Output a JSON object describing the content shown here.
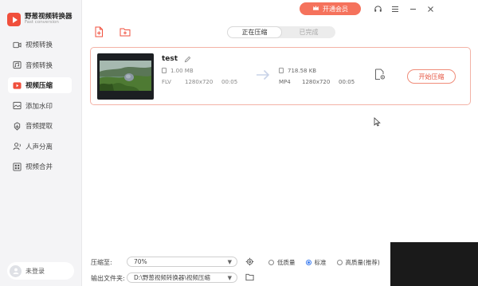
{
  "app": {
    "title": "野葱视频转换器",
    "subtitle": "Fast conversion"
  },
  "sidebar": {
    "items": [
      {
        "label": "视频转换",
        "icon": "video-convert-icon",
        "active": false
      },
      {
        "label": "音频转换",
        "icon": "audio-convert-icon",
        "active": false
      },
      {
        "label": "视频压缩",
        "icon": "video-compress-icon",
        "active": true
      },
      {
        "label": "添加水印",
        "icon": "watermark-icon",
        "active": false
      },
      {
        "label": "音频提取",
        "icon": "audio-extract-icon",
        "active": false
      },
      {
        "label": "人声分离",
        "icon": "vocal-separate-icon",
        "active": false
      },
      {
        "label": "视频合并",
        "icon": "video-merge-icon",
        "active": false
      }
    ],
    "user_label": "未登录"
  },
  "titlebar": {
    "vip_label": "开通会员"
  },
  "tabs": [
    {
      "label": "正在压缩",
      "active": true
    },
    {
      "label": "已完成",
      "active": false
    }
  ],
  "file": {
    "name": "test",
    "source": {
      "size": "1.00 MB",
      "format": "FLV",
      "resolution": "1280x720",
      "duration": "00:05"
    },
    "target": {
      "size": "718.58 KB",
      "format": "MP4",
      "resolution": "1280x720",
      "duration": "00:05"
    },
    "start_label": "开始压缩"
  },
  "bottom": {
    "ratio_label": "压缩至:",
    "ratio_value": "70%",
    "quality_options": [
      {
        "label": "低质量",
        "selected": false
      },
      {
        "label": "标准",
        "selected": true
      },
      {
        "label": "高质量(推荐)",
        "selected": false
      }
    ],
    "output_label": "输出文件夹:",
    "output_value": "D:\\野葱视频转换器\\视频压缩"
  },
  "colors": {
    "accent": "#f5725c",
    "brand": "#f04f3c",
    "radio_selected": "#3b7cf0"
  }
}
